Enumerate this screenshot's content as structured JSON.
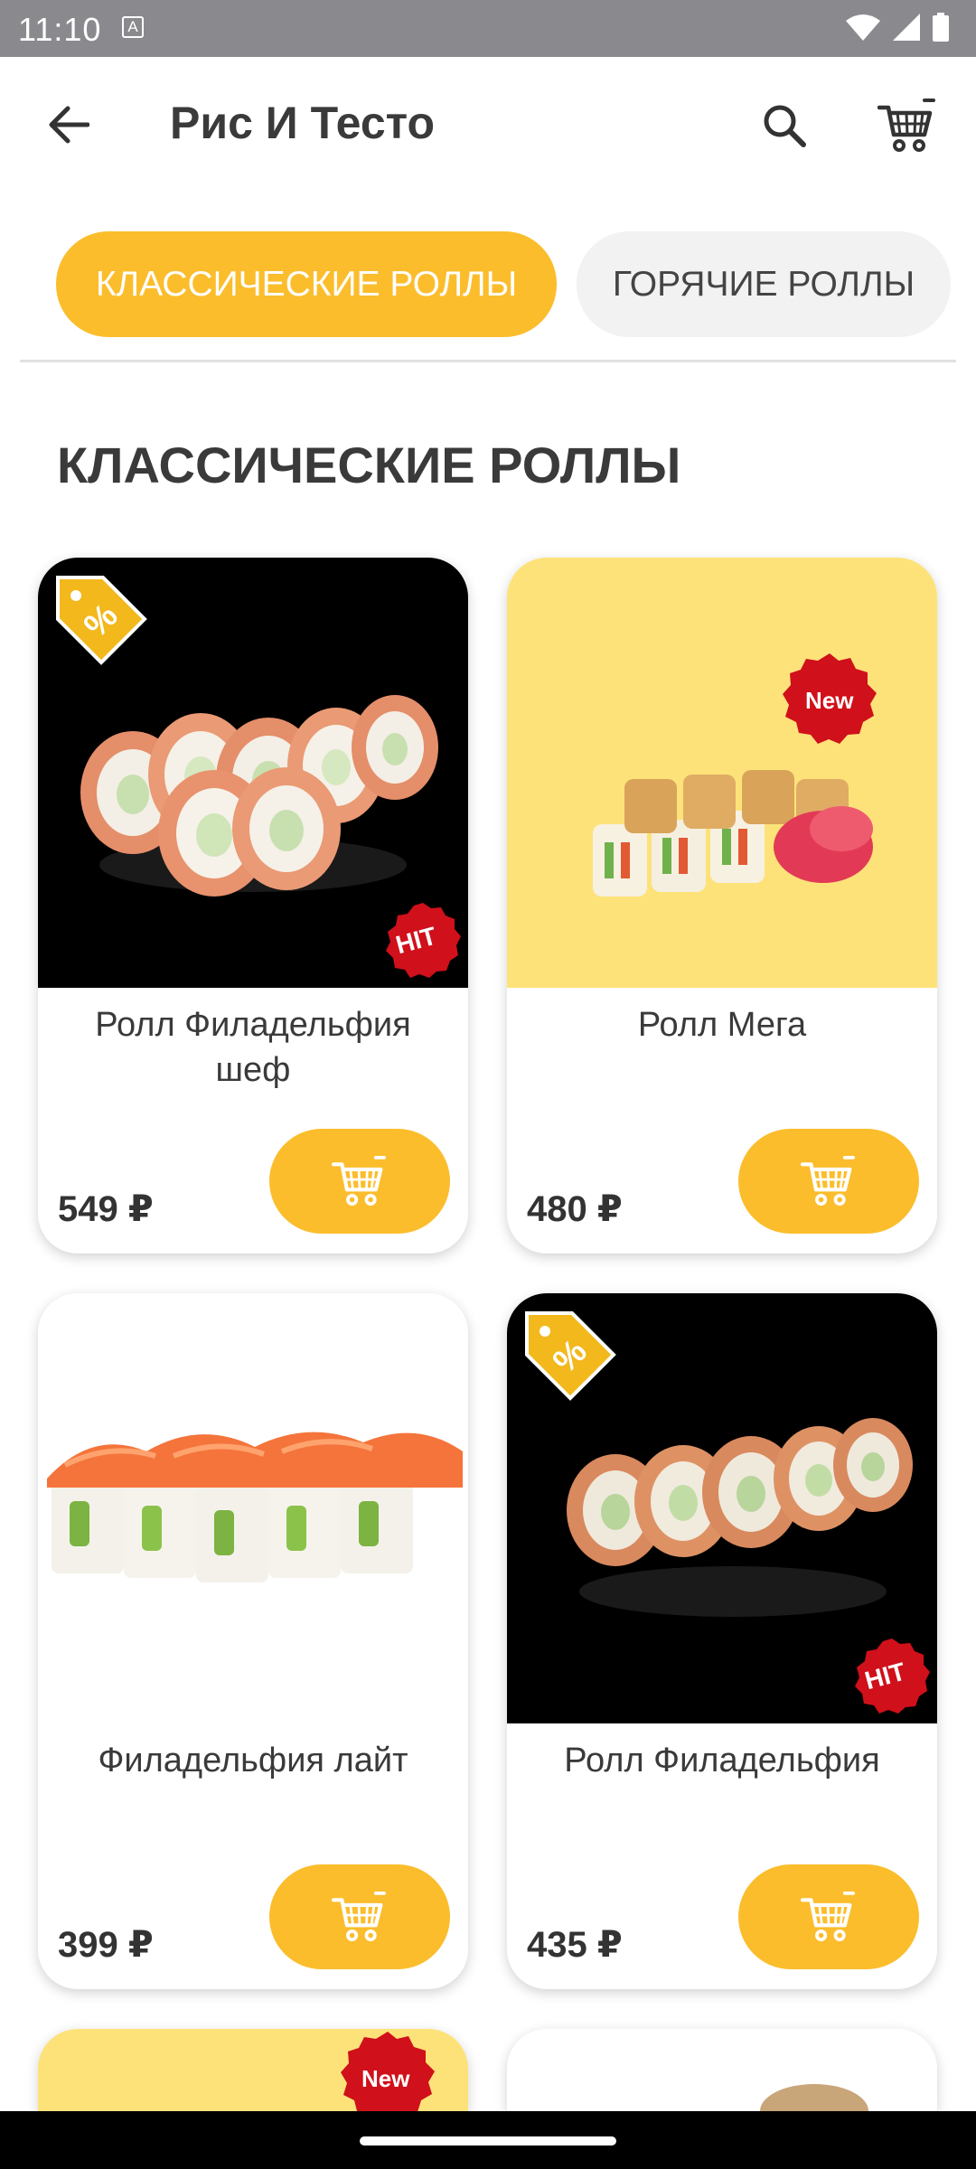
{
  "status_bar": {
    "time": "11:10",
    "notification_letter": "A"
  },
  "header": {
    "title": "Рис И Тесто"
  },
  "tabs": [
    {
      "label": "КЛАССИЧЕСКИЕ РОЛЛЫ",
      "active": true
    },
    {
      "label": "ГОРЯЧИЕ РОЛЛЫ",
      "active": false
    }
  ],
  "section": {
    "title": "КЛАССИЧЕСКИЕ РОЛЛЫ"
  },
  "badges": {
    "hit": "HIT",
    "new": "New"
  },
  "products": [
    {
      "name": "Ролл Филадельфия шеф",
      "price": "549 ₽",
      "badges": [
        "discount",
        "hit"
      ]
    },
    {
      "name": "Ролл Мега",
      "price": "480 ₽",
      "badges": [
        "new"
      ]
    },
    {
      "name": "Филадельфия лайт",
      "price": "399 ₽",
      "badges": []
    },
    {
      "name": "Ролл Филадельфия",
      "price": "435 ₽",
      "badges": [
        "discount",
        "hit"
      ]
    }
  ],
  "colors": {
    "accent": "#fbbd2c",
    "badge_red": "#d0101a",
    "tab_inactive": "#f2f2f2",
    "status_bar": "#8a8a8e"
  }
}
